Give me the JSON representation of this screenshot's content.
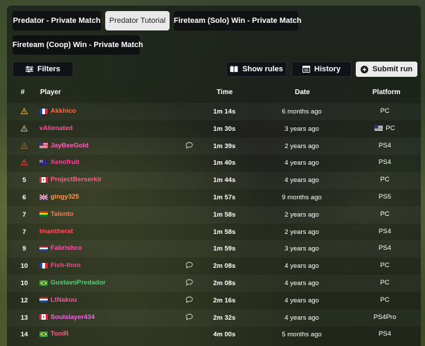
{
  "tabs": [
    {
      "label": "Predator - Private Match"
    },
    {
      "label": "Predator Tutorial"
    },
    {
      "label": "Fireteam (Solo) Win - Private Match"
    },
    {
      "label": "Fireteam (Coop) Win - Private Match"
    }
  ],
  "toolbar": {
    "filters_label": "Filters",
    "show_rules_label": "Show rules",
    "history_label": "History",
    "submit_run_label": "Submit run"
  },
  "table": {
    "headers": {
      "rank": "#",
      "player": "Player",
      "time": "Time",
      "date": "Date",
      "platform": "Platform"
    },
    "rows": [
      {
        "rank": "",
        "rank_icon": "warning-icon",
        "rank_icon_color": "#d6a93a",
        "flag": "fr",
        "player": "Akkhico",
        "color": "#ff6a3d",
        "comment": false,
        "time_main": "1m",
        "time_sec": "14s",
        "date": "6 months ago",
        "platform": "PC",
        "platform_flag": ""
      },
      {
        "rank": "",
        "rank_icon": "warning-icon",
        "rank_icon_color": "#c9b27a",
        "flag": "",
        "player": "vAlienated",
        "color": "#ff4d9e",
        "comment": false,
        "time_main": "1m",
        "time_sec": "30s",
        "date": "3 years ago",
        "platform": "PC",
        "platform_flag": "us"
      },
      {
        "rank": "",
        "rank_icon": "warning-icon",
        "rank_icon_color": "#8a6a3a",
        "flag": "us",
        "player": "JayBeeGold",
        "color": "#ff5fb8",
        "comment": true,
        "time_main": "1m",
        "time_sec": "39s",
        "date": "2 years ago",
        "platform": "PS4",
        "platform_flag": ""
      },
      {
        "rank": "",
        "rank_icon": "warning-icon",
        "rank_icon_color": "#e0413a",
        "flag": "nz",
        "player": "Xenofruit",
        "color": "#ff3fa0",
        "comment": false,
        "time_main": "1m",
        "time_sec": "40s",
        "date": "4 years ago",
        "platform": "PS4",
        "platform_flag": ""
      },
      {
        "rank": "5",
        "rank_icon": "",
        "rank_icon_color": "",
        "flag": "ca",
        "player": "ProjectBerserkir",
        "color": "#ff5a8a",
        "comment": false,
        "time_main": "1m",
        "time_sec": "44s",
        "date": "4 years ago",
        "platform": "PC",
        "platform_flag": ""
      },
      {
        "rank": "6",
        "rank_icon": "",
        "rank_icon_color": "",
        "flag": "gb",
        "player": "gingy325",
        "color": "#ff9a4a",
        "comment": false,
        "time_main": "1m",
        "time_sec": "57s",
        "date": "9 months ago",
        "platform": "PS5",
        "platform_flag": ""
      },
      {
        "rank": "7",
        "rank_icon": "",
        "rank_icon_color": "",
        "flag": "bo",
        "player": "Talento",
        "color": "#ff7a4a",
        "comment": false,
        "time_main": "1m",
        "time_sec": "58s",
        "date": "2 years ago",
        "platform": "PC",
        "platform_flag": ""
      },
      {
        "rank": "7",
        "rank_icon": "",
        "rank_icon_color": "",
        "flag": "",
        "player": "Imantherat",
        "color": "#ff4d5a",
        "comment": false,
        "time_main": "1m",
        "time_sec": "58s",
        "date": "2 years ago",
        "platform": "PS4",
        "platform_flag": ""
      },
      {
        "rank": "9",
        "rank_icon": "",
        "rank_icon_color": "",
        "flag": "nl",
        "player": "Fabrishco",
        "color": "#ff4fa8",
        "comment": false,
        "time_main": "1m",
        "time_sec": "59s",
        "date": "3 years ago",
        "platform": "PS4",
        "platform_flag": ""
      },
      {
        "rank": "10",
        "rank_icon": "",
        "rank_icon_color": "",
        "flag": "fr",
        "player": "Fish-thon",
        "color": "#ff3fa0",
        "comment": true,
        "time_main": "2m",
        "time_sec": "08s",
        "date": "4 years ago",
        "platform": "PC",
        "platform_flag": ""
      },
      {
        "rank": "10",
        "rank_icon": "",
        "rank_icon_color": "",
        "flag": "br",
        "player": "GustavoPredador",
        "color": "#5cc97a",
        "comment": true,
        "time_main": "2m",
        "time_sec": "08s",
        "date": "4 years ago",
        "platform": "PC",
        "platform_flag": ""
      },
      {
        "rank": "12",
        "rank_icon": "",
        "rank_icon_color": "",
        "flag": "nl",
        "player": "LtNakuu",
        "color": "#ff4fa8",
        "comment": true,
        "time_main": "2m",
        "time_sec": "16s",
        "date": "4 years ago",
        "platform": "PC",
        "platform_flag": ""
      },
      {
        "rank": "13",
        "rank_icon": "",
        "rank_icon_color": "",
        "flag": "ca",
        "player": "Soulslayer434",
        "color": "#e86ad8",
        "comment": true,
        "time_main": "2m",
        "time_sec": "32s",
        "date": "4 years ago",
        "platform": "PS4Pro",
        "platform_flag": ""
      },
      {
        "rank": "14",
        "rank_icon": "",
        "rank_icon_color": "",
        "flag": "br",
        "player": "ToniR",
        "color": "#ff5a8a",
        "comment": false,
        "time_main": "4m",
        "time_sec": "00s",
        "date": "5 months ago",
        "platform": "PS4",
        "platform_flag": ""
      }
    ]
  }
}
